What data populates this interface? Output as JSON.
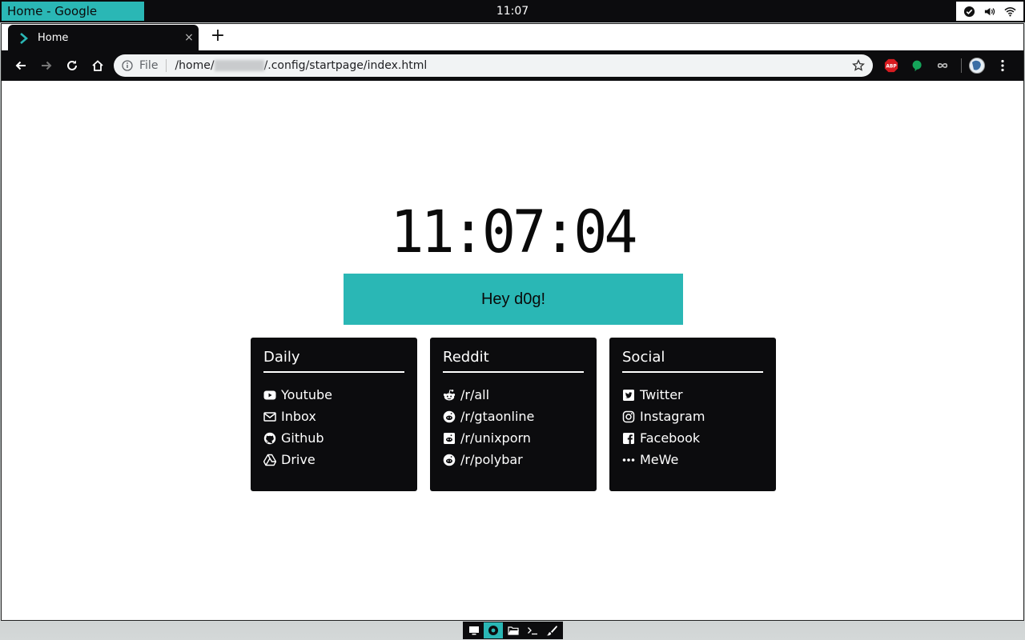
{
  "system_bar": {
    "window_title": "Home - Google Chrome",
    "clock": "11:07"
  },
  "browser": {
    "tab": {
      "label": "Home",
      "close": "×"
    },
    "new_tab": "+",
    "omnibox": {
      "scheme": "File",
      "url_prefix": "/home/",
      "url_suffix": "/.config/startpage/index.html"
    },
    "extensions": [
      "adblock-plus-icon",
      "grammarly-icon",
      "infinity-icon",
      "profile-avatar-icon"
    ]
  },
  "page": {
    "clock": "11:07:04",
    "greeting": "Hey d0g!",
    "cards": [
      {
        "title": "Daily",
        "links": [
          {
            "label": "Youtube",
            "icon": "youtube-icon"
          },
          {
            "label": "Inbox",
            "icon": "envelope-icon"
          },
          {
            "label": "Github",
            "icon": "github-icon"
          },
          {
            "label": "Drive",
            "icon": "google-drive-icon"
          }
        ]
      },
      {
        "title": "Reddit",
        "links": [
          {
            "label": "/r/all",
            "icon": "reddit-alien-icon"
          },
          {
            "label": "/r/gtaonline",
            "icon": "reddit-icon"
          },
          {
            "label": "/r/unixporn",
            "icon": "reddit-square-icon"
          },
          {
            "label": "/r/polybar",
            "icon": "reddit-icon"
          }
        ]
      },
      {
        "title": "Social",
        "links": [
          {
            "label": "Twitter",
            "icon": "twitter-square-icon"
          },
          {
            "label": "Instagram",
            "icon": "instagram-icon"
          },
          {
            "label": "Facebook",
            "icon": "facebook-square-icon"
          },
          {
            "label": "MeWe",
            "icon": "ellipsis-icon"
          }
        ]
      }
    ]
  },
  "dock": [
    "display-icon",
    "chrome-icon",
    "folder-icon",
    "terminal-icon",
    "brush-icon"
  ],
  "colors": {
    "accent": "#2ab7b5",
    "dark": "#0c0c0e"
  }
}
